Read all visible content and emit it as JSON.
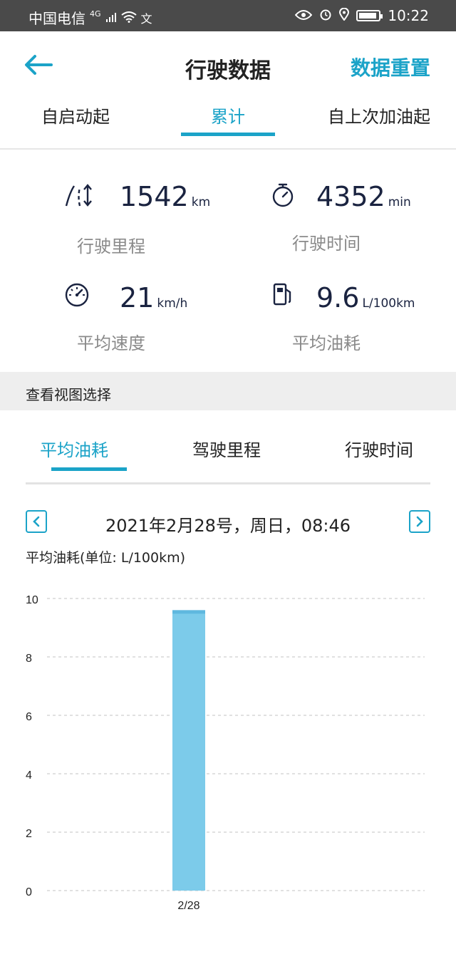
{
  "status_bar": {
    "carrier": "中国电信",
    "network": "4G",
    "extra": "文",
    "time": "10:22"
  },
  "header": {
    "title": "行驶数据",
    "reset_label": "数据重置"
  },
  "top_tabs": [
    {
      "label": "自启动起",
      "active": false
    },
    {
      "label": "累计",
      "active": true
    },
    {
      "label": "自上次加油起",
      "active": false
    }
  ],
  "stats": {
    "distance": {
      "value": "1542",
      "unit": "km",
      "label": "行驶里程",
      "icon": "road-icon"
    },
    "time": {
      "value": "4352",
      "unit": "min",
      "label": "行驶时间",
      "icon": "stopwatch-icon"
    },
    "speed": {
      "value": "21",
      "unit": "km/h",
      "label": "平均速度",
      "icon": "speedometer-icon"
    },
    "fuel": {
      "value": "9.6",
      "unit": "L/100km",
      "label": "平均油耗",
      "icon": "fuel-pump-icon"
    }
  },
  "section_header": "查看视图选择",
  "view_tabs": [
    {
      "label": "平均油耗",
      "active": true
    },
    {
      "label": "驾驶里程",
      "active": false
    },
    {
      "label": "行驶时间",
      "active": false
    }
  ],
  "date_nav": {
    "label": "2021年2月28号，周日，08:46"
  },
  "chart_caption": "平均油耗(单位: L/100km)",
  "colors": {
    "accent": "#1ba3c8",
    "bar": "#7ccbea",
    "value_text": "#1a2340"
  },
  "chart_data": {
    "type": "bar",
    "categories": [
      "2/28"
    ],
    "values": [
      9.6
    ],
    "ylabel": "平均油耗(单位: L/100km)",
    "ylim": [
      0,
      10
    ],
    "yticks": [
      0,
      2,
      4,
      6,
      8,
      10
    ],
    "grid": true
  }
}
